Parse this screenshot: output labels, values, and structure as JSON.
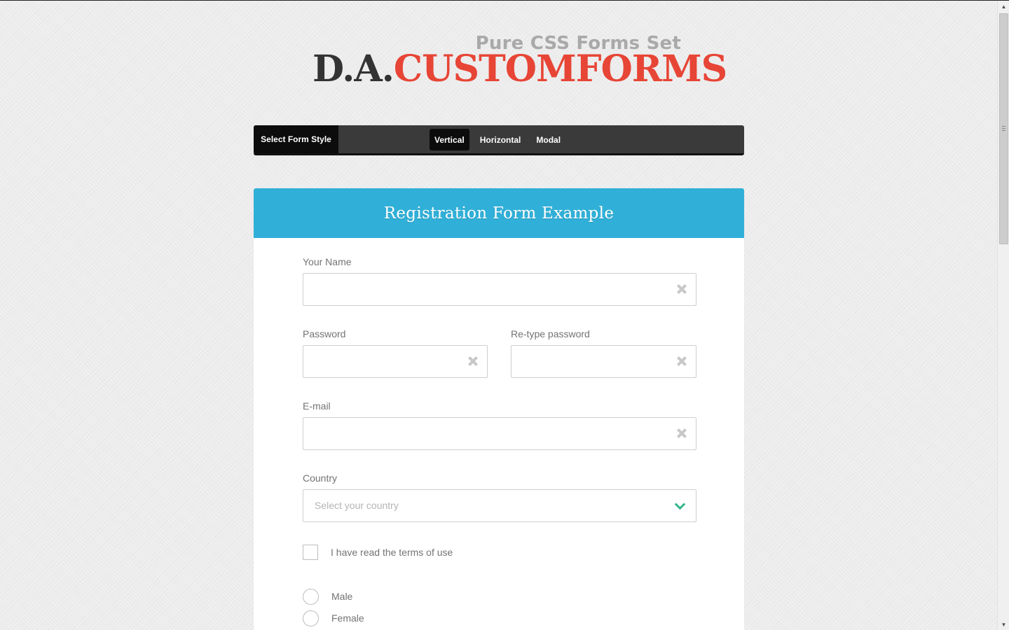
{
  "logo": {
    "subtitle": "Pure CSS Forms Set",
    "prefix": "D.A.",
    "name": "CUSTOMFORMS"
  },
  "style_bar": {
    "label": "Select Form Style",
    "tabs": [
      {
        "label": "Vertical",
        "active": true
      },
      {
        "label": "Horizontal",
        "active": false
      },
      {
        "label": "Modal",
        "active": false
      }
    ]
  },
  "form": {
    "title": "Registration Form Example",
    "name_label": "Your Name",
    "name_value": "",
    "password_label": "Password",
    "password_value": "",
    "retype_label": "Re-type password",
    "retype_value": "",
    "email_label": "E-mail",
    "email_value": "",
    "country_label": "Country",
    "country_placeholder": "Select your country",
    "terms_label": "I have read the terms of use",
    "terms_checked": false,
    "gender_options": [
      "Male",
      "Female"
    ],
    "clear_icon": "close-icon",
    "dropdown_icon": "chevron-down-icon"
  },
  "colors": {
    "header_blue": "#30b0d8",
    "brand_red": "#e74536",
    "chevron_green": "#35b58e"
  }
}
